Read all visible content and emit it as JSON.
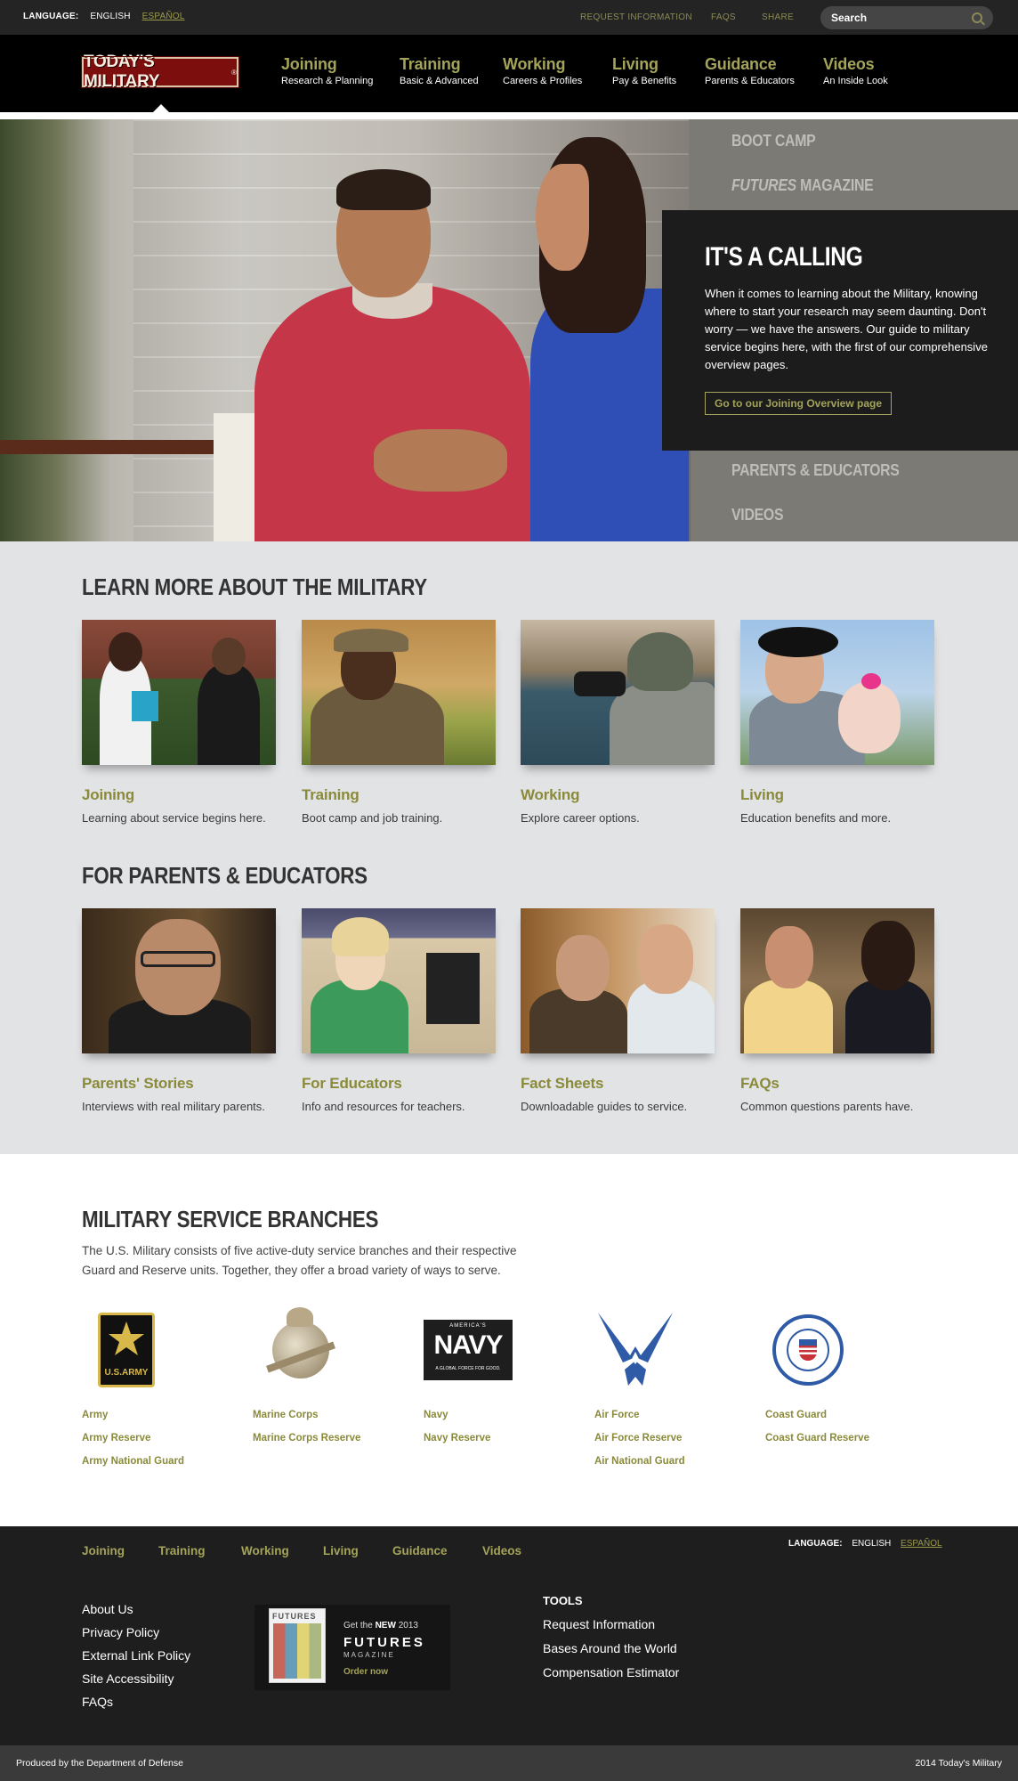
{
  "utility": {
    "language_label": "LANGUAGE:",
    "english": "ENGLISH",
    "espanol": "ESPAÑOL",
    "request_info": "REQUEST INFORMATION",
    "faqs": "FAQS",
    "share": "SHARE",
    "search_placeholder": "Search"
  },
  "logo": "TODAY'S MILITARY",
  "nav": [
    {
      "title": "Joining",
      "sub": "Research & Planning"
    },
    {
      "title": "Training",
      "sub": "Basic & Advanced"
    },
    {
      "title": "Working",
      "sub": "Careers & Profiles"
    },
    {
      "title": "Living",
      "sub": "Pay & Benefits"
    },
    {
      "title": "Guidance",
      "sub": "Parents & Educators"
    },
    {
      "title": "Videos",
      "sub": "An Inside Look"
    }
  ],
  "hero": {
    "menu_boot_camp": "BOOT CAMP",
    "menu_futures_italic": "FUTURES",
    "menu_futures_rest": " MAGAZINE",
    "menu_parents": "PARENTS & EDUCATORS",
    "menu_videos": "VIDEOS",
    "callout_title": "IT'S A CALLING",
    "callout_text": "When it comes to learning about the Military, knowing where to start your research may seem daunting. Don't worry — we have the answers. Our guide to military service begins here, with the first of our comprehensive overview pages.",
    "callout_button": "Go to our Joining Overview page"
  },
  "learn": {
    "title": "LEARN MORE ABOUT THE MILITARY",
    "cards": [
      {
        "title": "Joining",
        "desc": "Learning about service begins here."
      },
      {
        "title": "Training",
        "desc": "Boot camp and job training."
      },
      {
        "title": "Working",
        "desc": "Explore career options."
      },
      {
        "title": "Living",
        "desc": "Education benefits and more."
      }
    ]
  },
  "parents": {
    "title": "FOR PARENTS & EDUCATORS",
    "cards": [
      {
        "title": "Parents' Stories",
        "desc": "Interviews with real military parents."
      },
      {
        "title": "For Educators",
        "desc": "Info and resources for teachers."
      },
      {
        "title": "Fact Sheets",
        "desc": "Downloadable guides to service."
      },
      {
        "title": "FAQs",
        "desc": "Common questions parents have."
      }
    ]
  },
  "branches": {
    "title": "MILITARY SERVICE BRANCHES",
    "intro": "The U.S. Military consists of five active-duty service branches and their respective Guard and Reserve units. Together, they offer a broad variety of ways to serve.",
    "army": {
      "emblem": "U.S.ARMY",
      "links": [
        "Army",
        "Army Reserve",
        "Army National Guard"
      ]
    },
    "marines": {
      "links": [
        "Marine Corps",
        "Marine Corps Reserve"
      ]
    },
    "navy": {
      "emblem_top": "AMERICA'S",
      "emblem_main": "NAVY",
      "emblem_tag": "A GLOBAL FORCE FOR GOOD.",
      "links": [
        "Navy",
        "Navy Reserve"
      ]
    },
    "airforce": {
      "links": [
        "Air Force",
        "Air Force Reserve",
        "Air National Guard"
      ]
    },
    "coastguard": {
      "links": [
        "Coast Guard",
        "Coast Guard Reserve"
      ]
    }
  },
  "footer": {
    "nav": [
      "Joining",
      "Training",
      "Working",
      "Living",
      "Guidance",
      "Videos"
    ],
    "language_label": "LANGUAGE:",
    "english": "ENGLISH",
    "espanol": "ESPAÑOL",
    "links": [
      "About Us",
      "Privacy Policy",
      "External Link Policy",
      "Site Accessibility",
      "FAQs"
    ],
    "promo": {
      "get": "Get the ",
      "new": "NEW",
      "year": " 2013",
      "title": "FUTURES",
      "magazine": "MAGAZINE",
      "cover_title": "FUTURES",
      "order": "Order now"
    },
    "tools_title": "TOOLS",
    "tools": [
      "Request Information",
      "Bases Around the World",
      "Compensation Estimator"
    ],
    "produced_by": "Produced by the Department of Defense",
    "copyright": "2014 Today's Military"
  },
  "colors": {
    "accent": "#a4a35a",
    "link_olive": "#8a8a3a",
    "dark": "#1c1c1c",
    "section_gray": "#e2e3e5",
    "logo_red": "#7d0e0e"
  }
}
